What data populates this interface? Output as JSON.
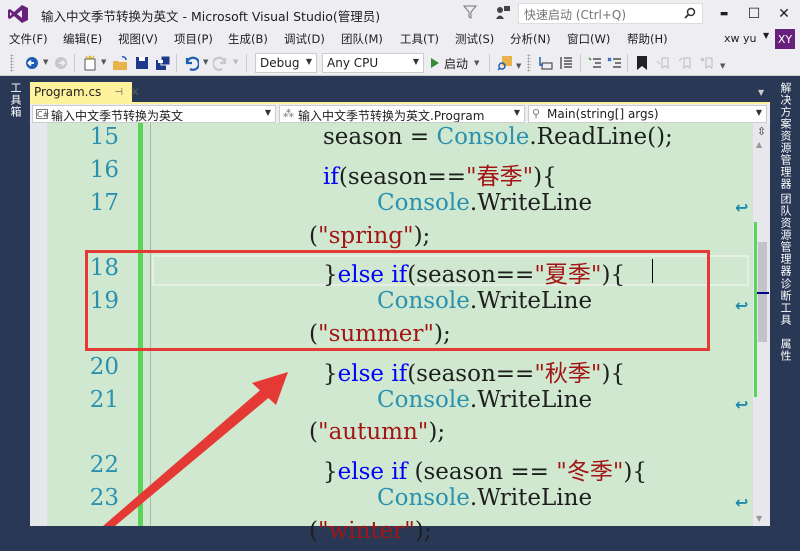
{
  "window": {
    "title": "输入中文季节转换为英文 - Microsoft Visual Studio(管理员)",
    "quick_launch_placeholder": "快速启动 (Ctrl+Q)",
    "controls": {
      "minimize": "▬",
      "maximize": "☐",
      "close": "✕"
    }
  },
  "menu": {
    "items": [
      "文件(F)",
      "编辑(E)",
      "视图(V)",
      "项目(P)",
      "生成(B)",
      "调试(D)",
      "团队(M)",
      "工具(T)",
      "测试(S)",
      "分析(N)",
      "窗口(W)",
      "帮助(H)"
    ],
    "user": "xw yu",
    "avatar": "XY"
  },
  "toolbar": {
    "config": "Debug",
    "platform": "Any CPU",
    "start": "启动",
    "icons": [
      "back-icon",
      "forward-icon",
      "new-project-icon",
      "open-file-icon",
      "save-icon",
      "save-all-icon",
      "undo-icon",
      "redo-icon",
      "start-icon",
      "find-icon",
      "step-into-icon",
      "format-icon",
      "comment-icon",
      "uncomment-icon",
      "bookmark-icon",
      "prev-bookmark-icon",
      "next-bookmark-icon",
      "clear-bookmarks-icon"
    ]
  },
  "side_panels": {
    "left": [
      "工具箱"
    ],
    "right": [
      "解决方案资源管理器",
      "团队资源管理器",
      "诊断工具",
      "属性"
    ]
  },
  "editor": {
    "tab": {
      "label": "Program.cs",
      "pin": "⊣",
      "close": "✕"
    },
    "nav": {
      "project": "输入中文季节转换为英文",
      "class": "输入中文季节转换为英文.Program",
      "member": "Main(string[] args)"
    },
    "lines": [
      {
        "num": "15",
        "tokens": [
          {
            "t": "season = ",
            "c": ""
          },
          {
            "t": "Console",
            "c": "ty"
          },
          {
            "t": ".ReadLine();",
            "c": ""
          }
        ],
        "indent": "l1"
      },
      {
        "num": "16",
        "tokens": [
          {
            "t": "if",
            "c": "kw"
          },
          {
            "t": "(season==",
            "c": ""
          },
          {
            "t": "\"春季\"",
            "c": "str"
          },
          {
            "t": "){",
            "c": ""
          }
        ],
        "indent": "l1"
      },
      {
        "num": "17",
        "tokens": [
          {
            "t": "Console",
            "c": "ty"
          },
          {
            "t": ".WriteLine",
            "c": ""
          }
        ],
        "indent": "l2",
        "wrap": true
      },
      {
        "num": "",
        "tokens": [
          {
            "t": "(",
            "c": ""
          },
          {
            "t": "\"spring\"",
            "c": "str"
          },
          {
            "t": ");",
            "c": ""
          }
        ],
        "indent": "l0"
      },
      {
        "num": "18",
        "tokens": [
          {
            "t": "}",
            "c": ""
          },
          {
            "t": "else if",
            "c": "kw"
          },
          {
            "t": "(season==",
            "c": ""
          },
          {
            "t": "\"夏季\"",
            "c": "str"
          },
          {
            "t": "){",
            "c": ""
          }
        ],
        "indent": "l1"
      },
      {
        "num": "19",
        "tokens": [
          {
            "t": "Console",
            "c": "ty"
          },
          {
            "t": ".WriteLine",
            "c": ""
          }
        ],
        "indent": "l2",
        "wrap": true
      },
      {
        "num": "",
        "tokens": [
          {
            "t": "(",
            "c": ""
          },
          {
            "t": "\"summer\"",
            "c": "str"
          },
          {
            "t": ");",
            "c": ""
          }
        ],
        "indent": "l0"
      },
      {
        "num": "20",
        "tokens": [
          {
            "t": "}",
            "c": ""
          },
          {
            "t": "else if",
            "c": "kw"
          },
          {
            "t": "(season==",
            "c": ""
          },
          {
            "t": "\"秋季\"",
            "c": "str"
          },
          {
            "t": "){",
            "c": ""
          }
        ],
        "indent": "l1"
      },
      {
        "num": "21",
        "tokens": [
          {
            "t": "Console",
            "c": "ty"
          },
          {
            "t": ".WriteLine",
            "c": ""
          }
        ],
        "indent": "l2",
        "wrap": true
      },
      {
        "num": "",
        "tokens": [
          {
            "t": "(",
            "c": ""
          },
          {
            "t": "\"autumn\"",
            "c": "str"
          },
          {
            "t": ");",
            "c": ""
          }
        ],
        "indent": "l0"
      },
      {
        "num": "22",
        "tokens": [
          {
            "t": "}",
            "c": ""
          },
          {
            "t": "else if",
            "c": "kw"
          },
          {
            "t": " (season == ",
            "c": ""
          },
          {
            "t": "\"冬季\"",
            "c": "str"
          },
          {
            "t": "){",
            "c": ""
          }
        ],
        "indent": "l1"
      },
      {
        "num": "23",
        "tokens": [
          {
            "t": "Console",
            "c": "ty"
          },
          {
            "t": ".WriteLine",
            "c": ""
          }
        ],
        "indent": "l2",
        "wrap": true
      },
      {
        "num": "",
        "tokens": [
          {
            "t": "(",
            "c": ""
          },
          {
            "t": "\"winter\"",
            "c": "str"
          },
          {
            "t": ");",
            "c": ""
          }
        ],
        "indent": "l0"
      }
    ]
  },
  "annotation": {
    "color": "#e53935",
    "highlighted_lines": [
      "18",
      "19"
    ]
  },
  "colors": {
    "accent": "#68217a",
    "keyword": "#0000ff",
    "type": "#2b91af",
    "string": "#a31515",
    "editor_bg": "#cfe8cf",
    "change_bar": "#5cd35a",
    "active_tab": "#fff29d"
  }
}
